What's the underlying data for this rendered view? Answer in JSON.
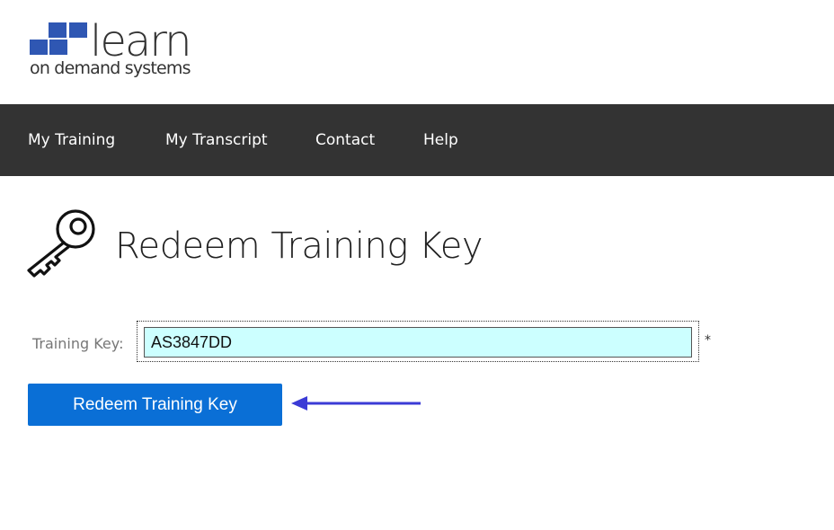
{
  "brand": {
    "word": "learn",
    "tagline": "on demand systems",
    "color": "#2f57b3"
  },
  "nav": {
    "background": "#333333",
    "items": [
      {
        "label": "My Training"
      },
      {
        "label": "My Transcript"
      },
      {
        "label": "Contact"
      },
      {
        "label": "Help"
      }
    ]
  },
  "page": {
    "title": "Redeem Training Key",
    "icon": "key-icon"
  },
  "form": {
    "label": "Training Key:",
    "value": "AS3847DD",
    "required_mark": "*",
    "input_background": "#ccffff",
    "submit_label": "Redeem Training Key",
    "submit_color": "#0a6fd6"
  },
  "annotation": {
    "icon": "arrow-left-icon",
    "color": "#3b3bd6"
  }
}
